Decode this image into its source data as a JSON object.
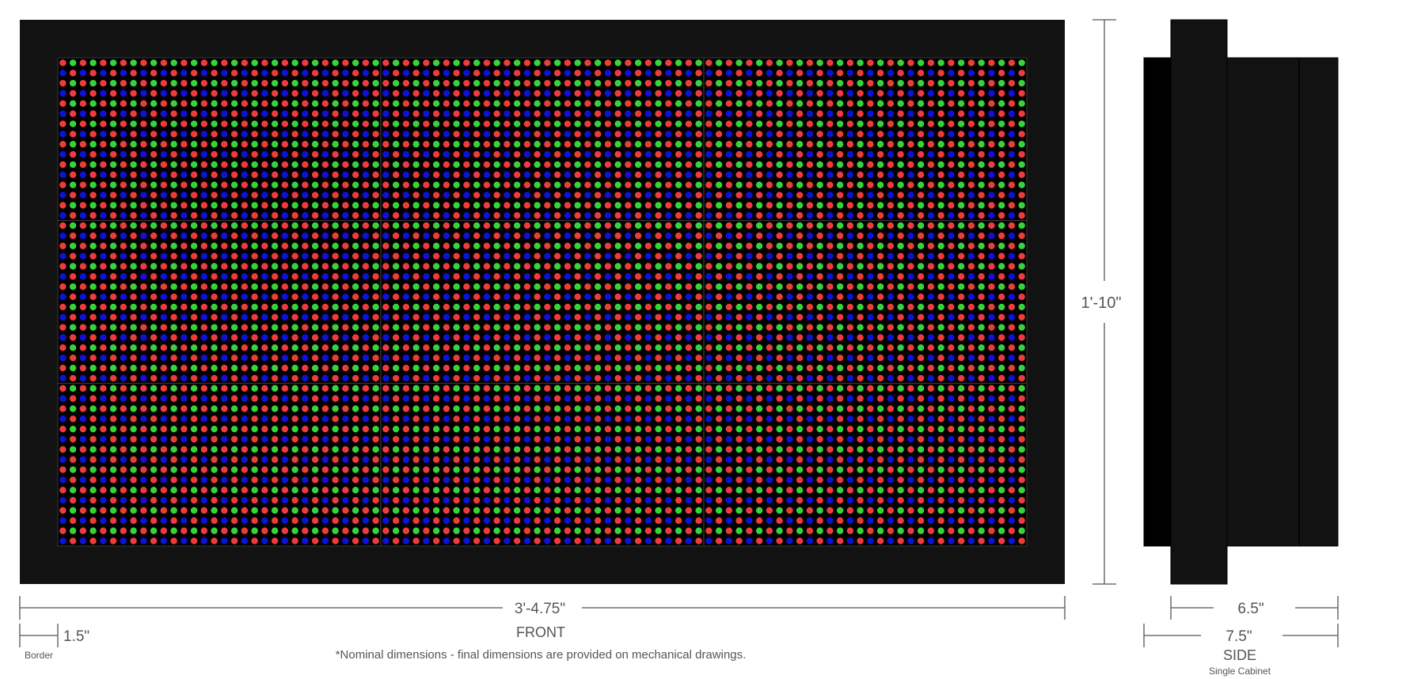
{
  "front": {
    "label": "FRONT",
    "width_dim": "3'-4.75\"",
    "height_dim": "1'-10\"",
    "border_dim": "1.5\"",
    "border_label": "Border",
    "module_grid": {
      "columns": 3,
      "rows": 3
    },
    "led_colors": {
      "red": "#ee3b3b",
      "green": "#3ad23a",
      "blue": "#1010d8"
    },
    "frame_color": "#121212"
  },
  "side": {
    "label": "SIDE",
    "sublabel": "Single Cabinet",
    "depth_dim": "6.5\"",
    "overall_dim": "7.5\""
  },
  "footnote": "*Nominal dimensions - final dimensions are provided on mechanical drawings."
}
